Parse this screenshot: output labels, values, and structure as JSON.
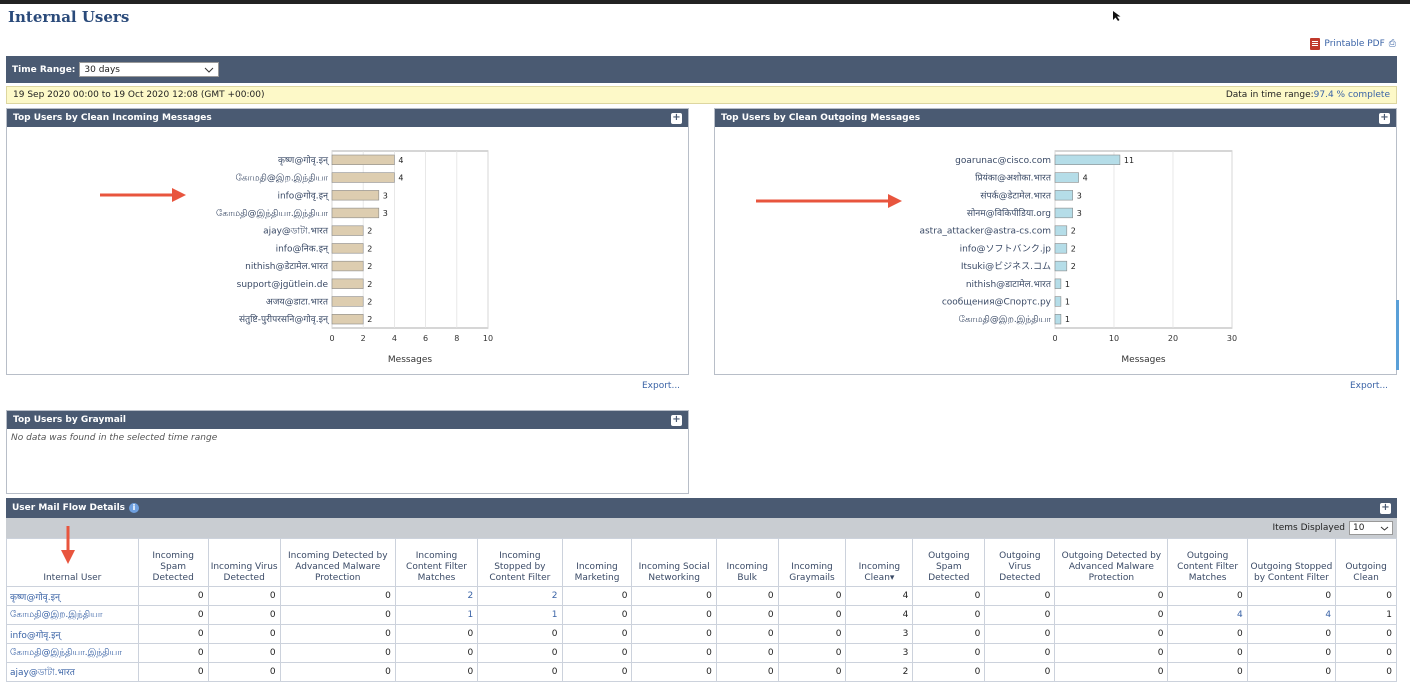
{
  "page": {
    "title": "Internal Users",
    "printable": "Printable PDF",
    "print_glyph": "⎙"
  },
  "time": {
    "label": "Time Range:",
    "value": "30 days"
  },
  "range": {
    "period": "19 Sep 2020 00:00 to 19 Oct 2020 12:08 (GMT +00:00)",
    "complete_label": "Data in time range:",
    "complete_value": "97.4 % complete"
  },
  "incoming": {
    "title": "Top Users by Clean Incoming Messages",
    "export": "Export...",
    "chart_data": {
      "type": "bar",
      "orientation": "horizontal",
      "categories": [
        "कृष्ण@गोवृ.इन्",
        "கோமதி@இற.இந்தியா",
        "info@गोवृ.इन्",
        "கோமதி@இந்தியா.இந்தியா",
        "ajay@ডাটা.भारत",
        "info@निक.इन्",
        "nithish@डेटामेल.भारत",
        "support@jgütlein.de",
        "अजय@डाटा.भारत",
        "संतुष्टि-पुरीपरसनि@गोवृ.इन्"
      ],
      "values": [
        4,
        4,
        3,
        3,
        2,
        2,
        2,
        2,
        2,
        2
      ],
      "xlabel": "Messages",
      "xticks": [
        0,
        2,
        4,
        6,
        8,
        10
      ],
      "xlim": [
        0,
        10
      ],
      "bar_color": "#ddcdb0"
    }
  },
  "outgoing": {
    "title": "Top Users by Clean Outgoing Messages",
    "export": "Export...",
    "chart_data": {
      "type": "bar",
      "orientation": "horizontal",
      "categories": [
        "goarunac@cisco.com",
        "प्रियंका@अशोका.भारत",
        "संपर्क@डेटामेल.भारत",
        "सोनम@विकिपीडिया.org",
        "astra_attacker@astra-cs.com",
        "info@ソフトバンク.jp",
        "Itsuki@ビジネス.コム",
        "nithish@डाटामेल.भारत",
        "сообщения@Спортс.ру",
        "கோமதி@இற.இந்தியா"
      ],
      "values": [
        11,
        4,
        3,
        3,
        2,
        2,
        2,
        1,
        1,
        1
      ],
      "xlabel": "Messages",
      "xticks": [
        0,
        10,
        20,
        30
      ],
      "xlim": [
        0,
        30
      ],
      "bar_color": "#b5dde8"
    }
  },
  "graymail": {
    "title": "Top Users by Graymail",
    "empty": "No data was found in the selected time range"
  },
  "details": {
    "title": "User Mail Flow Details",
    "info_icon": "i",
    "items_label": "Items Displayed",
    "items_value": "10",
    "columns": [
      "Internal User",
      "Incoming Spam Detected",
      "Incoming Virus Detected",
      "Incoming Detected by Advanced Malware Protection",
      "Incoming Content Filter Matches",
      "Incoming Stopped by Content Filter",
      "Incoming Marketing",
      "Incoming Social Networking",
      "Incoming Bulk",
      "Incoming Graymails",
      "Incoming Clean▾",
      "Outgoing Spam Detected",
      "Outgoing Virus Detected",
      "Outgoing Detected by Advanced Malware Protection",
      "Outgoing Content Filter Matches",
      "Outgoing Stopped by Content Filter",
      "Outgoing Clean"
    ],
    "rows": [
      [
        "कृष्ण@गोवृ.इन्",
        "0",
        "0",
        "0",
        "2",
        "2",
        "0",
        "0",
        "0",
        "0",
        "4",
        "0",
        "0",
        "0",
        "0",
        "0",
        "0"
      ],
      [
        "கோமதி@இற.இந்தியா",
        "0",
        "0",
        "0",
        "1",
        "1",
        "0",
        "0",
        "0",
        "0",
        "4",
        "0",
        "0",
        "0",
        "4",
        "4",
        "1"
      ],
      [
        "info@गोवृ.इन्",
        "0",
        "0",
        "0",
        "0",
        "0",
        "0",
        "0",
        "0",
        "0",
        "3",
        "0",
        "0",
        "0",
        "0",
        "0",
        "0"
      ],
      [
        "கோமதி@இந்தியா.இந்தியா",
        "0",
        "0",
        "0",
        "0",
        "0",
        "0",
        "0",
        "0",
        "0",
        "3",
        "0",
        "0",
        "0",
        "0",
        "0",
        "0"
      ],
      [
        "ajay@ডাটা.भारत",
        "0",
        "0",
        "0",
        "0",
        "0",
        "0",
        "0",
        "0",
        "0",
        "2",
        "0",
        "0",
        "0",
        "0",
        "0",
        "0"
      ]
    ]
  },
  "colors": {
    "nav": "#4a5a72",
    "link": "#3a63a6",
    "arrow": "#e8553e",
    "range_bg": "#fdf9c8"
  }
}
